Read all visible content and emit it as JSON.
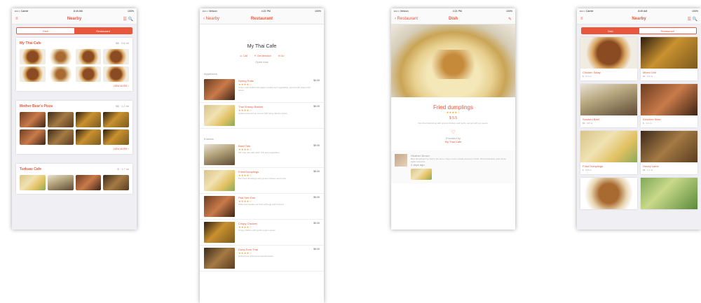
{
  "screen1": {
    "status": {
      "carrier": "•••○○ Carrier",
      "time": "8:49 AM",
      "battery": "100%"
    },
    "nav": {
      "title": "Nearby",
      "left": "≡",
      "right": "☰ 🔍"
    },
    "segments": [
      "Dish",
      "Restaurant"
    ],
    "cards": [
      {
        "name": "My Thai Cafe",
        "meta": "$$ · 0.8 mi",
        "more": "VIEW MORE ›"
      },
      {
        "name": "Mother Bear's Pizza",
        "meta": "$$ · 1.2 mi",
        "more": "VIEW MORE ›"
      },
      {
        "name": "Turkuaz Cafe",
        "meta": "$ · 1.7 mi"
      }
    ]
  },
  "screen2": {
    "status": {
      "carrier": "•••○○ Verizon",
      "time": "4:21 PM",
      "battery": "100%"
    },
    "nav": {
      "back": "‹ Nearby",
      "title": "Restaurant"
    },
    "name": "My Thai Cafe",
    "actions": [
      "☏ Call",
      "⇱ Get direction",
      "✉ Go"
    ],
    "hours": "Open now",
    "sections": [
      "Appetizers",
      "Entrees"
    ],
    "dishes": [
      {
        "name": "Spring Rolls",
        "stars": "★★★★☆",
        "price": "$4.00",
        "desc": "Crispy rolls stuffed with glass noodles and vegetables, served with sweet chili sauce."
      },
      {
        "name": "Thai Shrimp Basket",
        "stars": "★★★★☆",
        "price": "$6.00",
        "desc": "Golden fried shrimp served with tangy dipping sauce."
      },
      {
        "name": "Basil Tofu",
        "stars": "★★★★☆",
        "price": "$9.00",
        "desc": "Stir fried tofu with basil, chili and vegetables."
      },
      {
        "name": "Fried Dumplings",
        "stars": "★★★★☆",
        "price": "$6.00",
        "desc": "Pan fried dumplings with ground chicken and herbs."
      },
      {
        "name": "Pad See Ewe",
        "stars": "★★★★☆",
        "price": "$9.00",
        "desc": "Wide rice noodles stir fried with egg and broccoli."
      },
      {
        "name": "Crispy Chicken",
        "stars": "★★★★☆",
        "price": "$9.00",
        "desc": "Crispy chicken with garlic pepper sauce."
      },
      {
        "name": "Dong Dum Thai",
        "stars": "★★★★☆",
        "price": "$9.00",
        "desc": "Grilled beef with house special sauce."
      }
    ]
  },
  "screen3": {
    "status": {
      "carrier": "•••○○ Verizon",
      "time": "4:21 PM",
      "battery": "100%"
    },
    "nav": {
      "back": "‹ Restaurant",
      "title": "Dish"
    },
    "dish": "Fried dumplings",
    "stars": "★★★★☆",
    "price": "$ 5.5",
    "desc": "Pan fried dumplings with ground chicken and herbs, served with soy sauce.",
    "like": "♡",
    "from_label": "Provided by",
    "restaurant": "My Thai Cafe",
    "reviewer": "Heather Brown",
    "review": "Best dumplings I've had in the area, crispy on the outside and juicy inside. Would definitely order these again next time.",
    "review_meta": "2 days ago"
  },
  "screen4": {
    "status": {
      "carrier": "•••○○ Carrier",
      "time": "8:49 AM",
      "battery": "100%"
    },
    "nav": {
      "title": "Nearby",
      "left": "≡",
      "right": "☰ 🔍"
    },
    "segments": [
      "Dish",
      "Restaurant"
    ],
    "tiles": [
      {
        "name": "Chicken Satay",
        "meta": "$ · 0.4 mi"
      },
      {
        "name": "Mixed Grill",
        "meta": "$$ · 0.6 mi"
      },
      {
        "name": "Smoked Beef",
        "meta": "$$ · 0.8 mi"
      },
      {
        "name": "Kimchee Stew",
        "meta": "$ · 1.1 mi"
      },
      {
        "name": "Fried Dumplings",
        "meta": "$ · 0.8 mi"
      },
      {
        "name": "Honey Lamb",
        "meta": "$$ · 1.2 mi"
      }
    ]
  }
}
